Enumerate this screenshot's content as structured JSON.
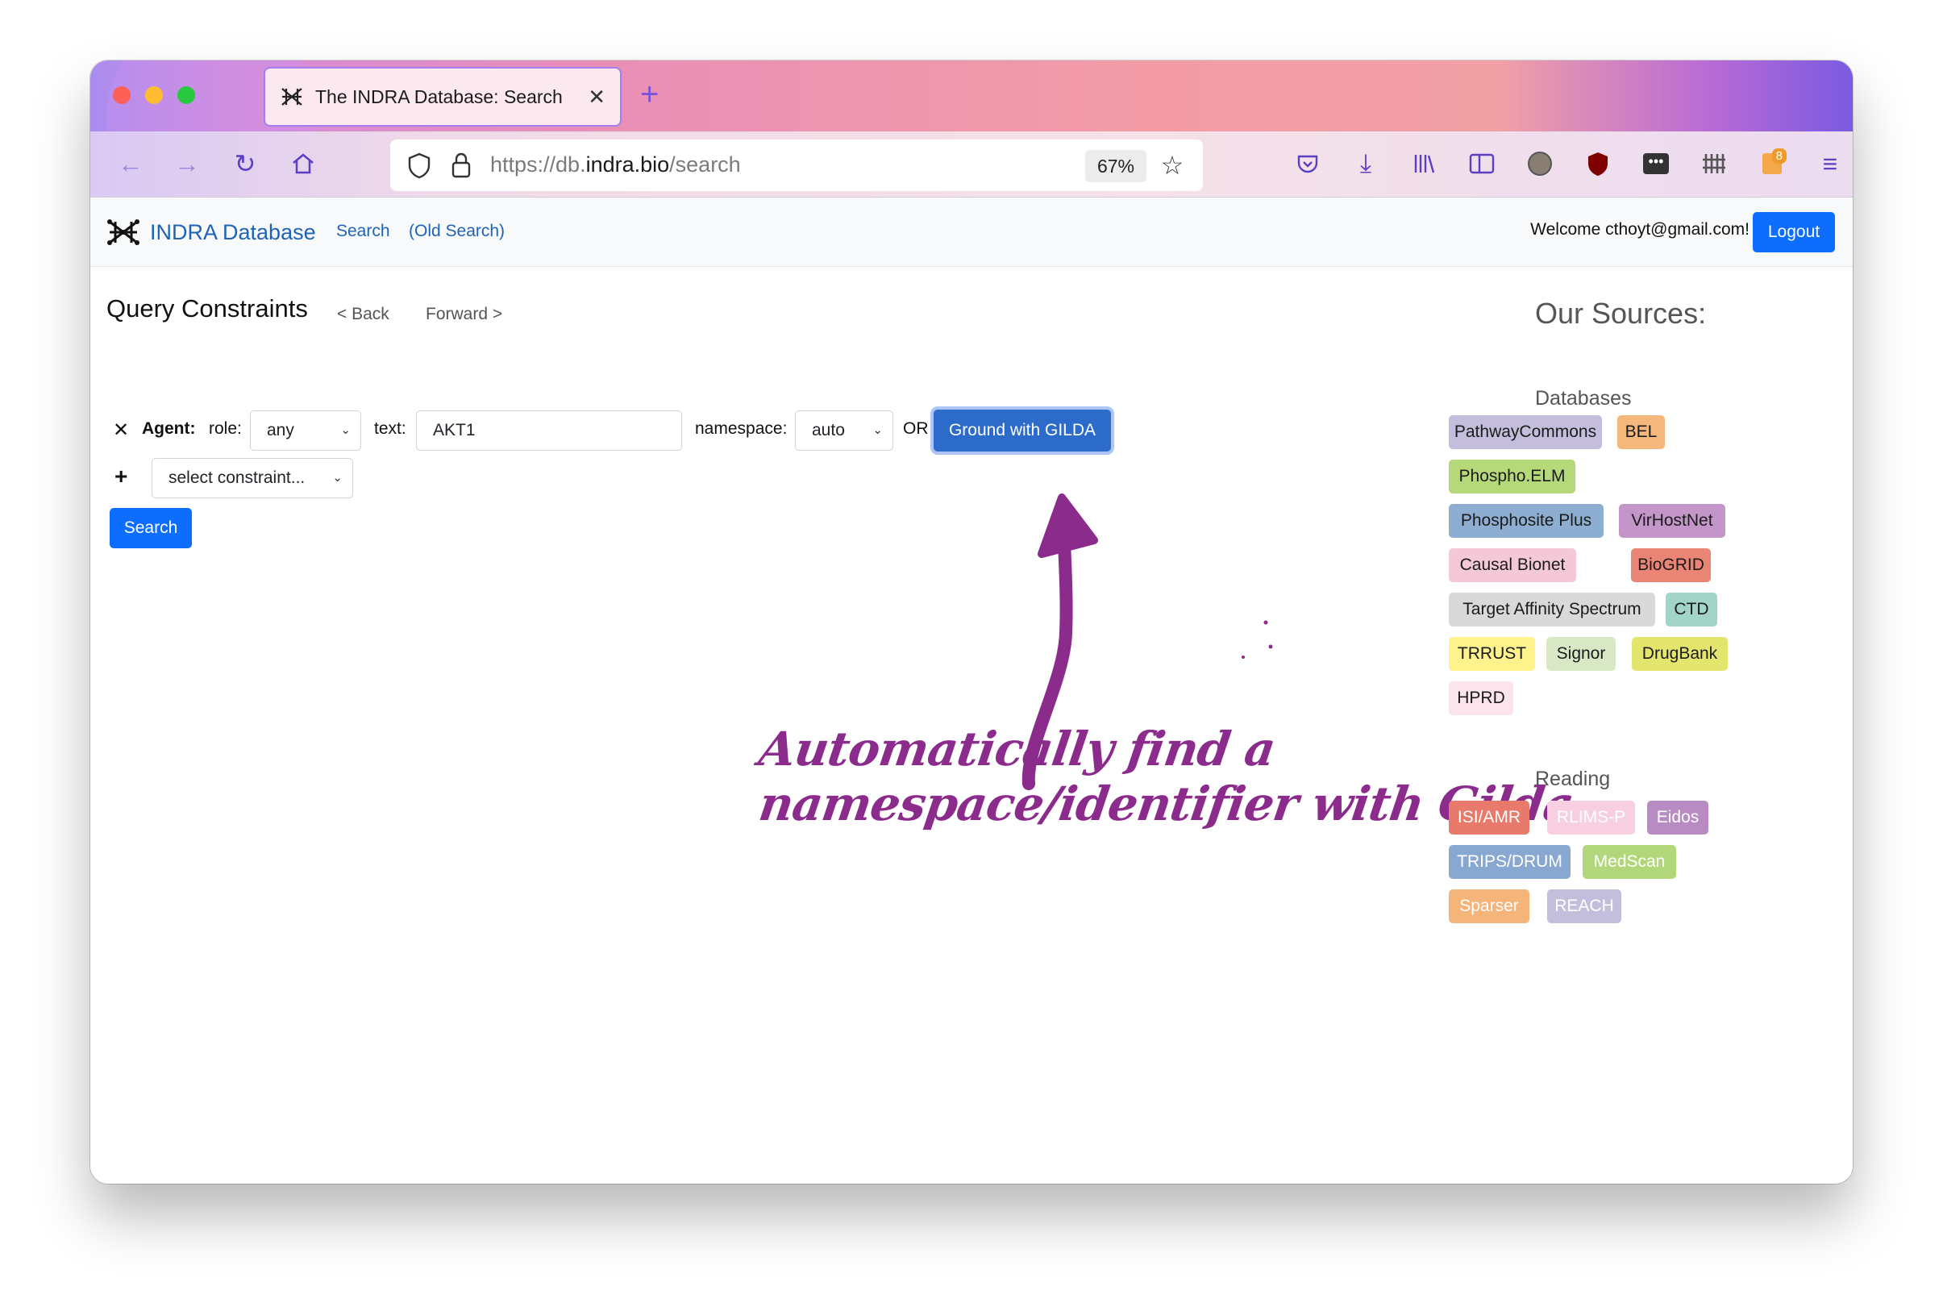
{
  "browser": {
    "tab_title": "The INDRA Database: Search",
    "new_tab_icon": "plus-icon",
    "url_prefix": "https://db.",
    "url_host": "indra.bio",
    "url_path": "/search",
    "zoom": "67%",
    "extension_badge": "8"
  },
  "navbar": {
    "brand": "INDRA Database",
    "search_link": "Search",
    "old_search_link": "(Old Search)",
    "welcome": "Welcome cthoyt@gmail.com!",
    "logout": "Logout"
  },
  "query": {
    "title": "Query Constraints",
    "back": "< Back",
    "forward": "Forward >",
    "agent_label": "Agent:",
    "role_label": "role:",
    "role_value": "any",
    "text_label": "text:",
    "text_value": "AKT1",
    "namespace_label": "namespace:",
    "namespace_value": "auto",
    "or_label": "OR",
    "gilda_button": "Ground with GILDA",
    "add_constraint_placeholder": "select constraint...",
    "search_button": "Search"
  },
  "annotation": {
    "line1": "Automatically find a",
    "line2": "namespace/identifier with Gilda",
    "color": "#8b2b8c"
  },
  "sources": {
    "title": "Our Sources:",
    "databases_title": "Databases",
    "databases": [
      {
        "label": "PathwayCommons",
        "color": "#c4bddb"
      },
      {
        "label": "BEL",
        "color": "#f4b77c"
      },
      {
        "label": "Phospho.ELM",
        "color": "#b5d879"
      },
      {
        "label": "Phosphosite Plus",
        "color": "#8eaed1"
      },
      {
        "label": "VirHostNet",
        "color": "#c495c9"
      },
      {
        "label": "Causal Bionet",
        "color": "#f5c8d8"
      },
      {
        "label": "BioGRID",
        "color": "#ea8575"
      },
      {
        "label": "Target Affinity Spectrum",
        "color": "#d9d9d9"
      },
      {
        "label": "CTD",
        "color": "#a2d5c8"
      },
      {
        "label": "TRRUST",
        "color": "#fdf28c"
      },
      {
        "label": "Signor",
        "color": "#d8e8c4"
      },
      {
        "label": "DrugBank",
        "color": "#e3e56d"
      },
      {
        "label": "HPRD",
        "color": "#fbe4ec"
      }
    ],
    "reading_title": "Reading",
    "reading": [
      {
        "label": "ISI/AMR",
        "color": "#e77a6b"
      },
      {
        "label": "RLIMS-P",
        "color": "#f7cfe0"
      },
      {
        "label": "Eidos",
        "color": "#b88cc2"
      },
      {
        "label": "TRIPS/DRUM",
        "color": "#88a8d1"
      },
      {
        "label": "MedScan",
        "color": "#b2d77a"
      },
      {
        "label": "Sparser",
        "color": "#f5b47a"
      },
      {
        "label": "REACH",
        "color": "#c3bedb"
      }
    ]
  }
}
